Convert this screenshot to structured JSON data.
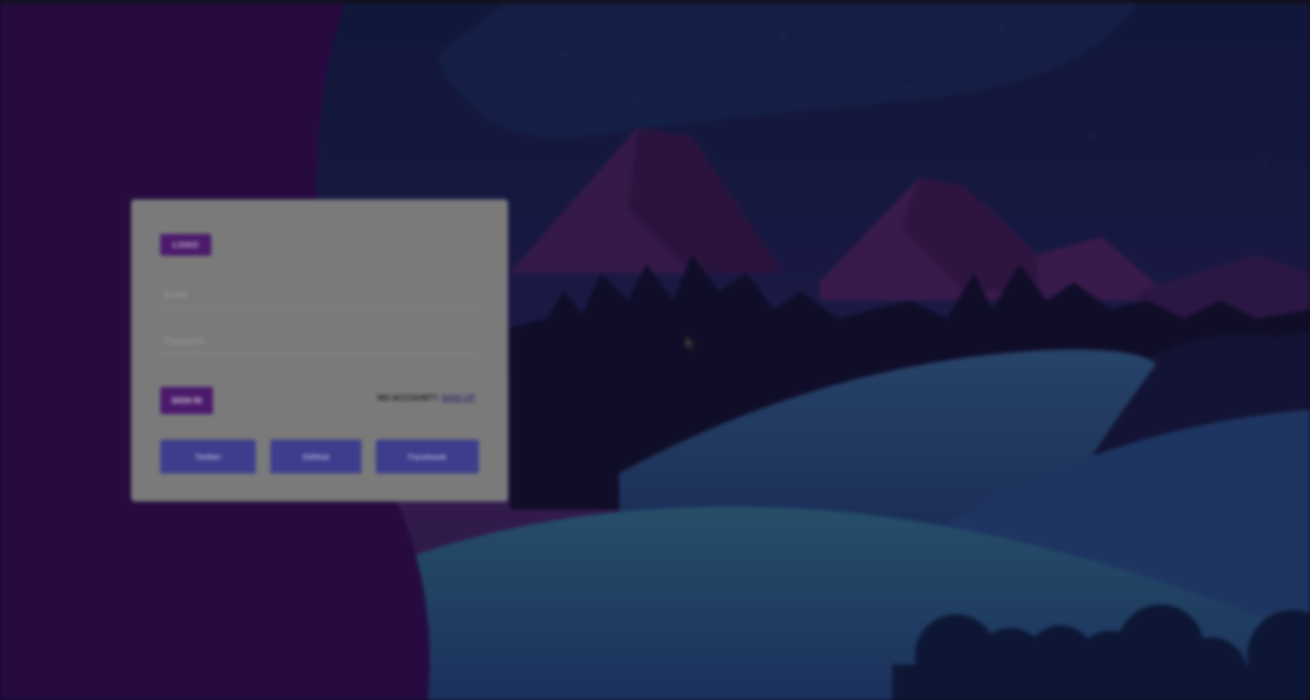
{
  "login": {
    "logo_text": "LOGO",
    "email_placeholder": "Email",
    "password_placeholder": "Password",
    "signin_label": "SIGN IN",
    "account_prompt": "NO ACCOUNT?",
    "signup_link": "SIGN UP",
    "social_buttons": [
      "Twitter",
      "GitHub",
      "Facebook"
    ]
  },
  "colors": {
    "left_panel": "#2a0b46",
    "card_bg": "#7a7a7b",
    "accent_purple": "#4b1a6b",
    "social_blue": "#3c3d8c"
  }
}
